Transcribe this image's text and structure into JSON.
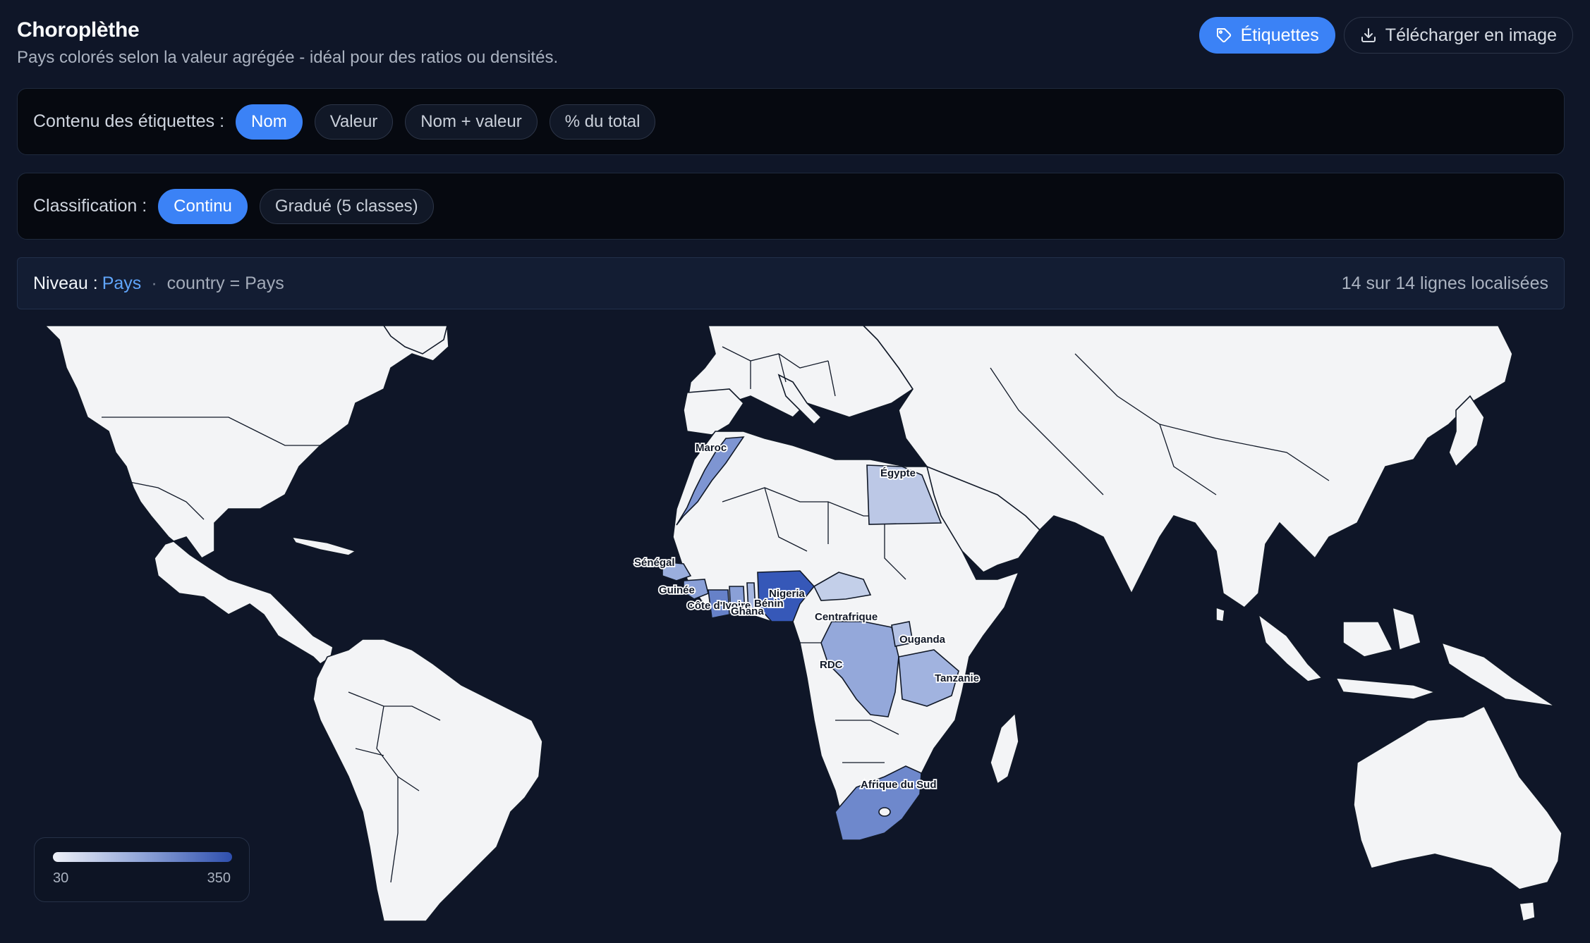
{
  "header": {
    "title": "Choroplèthe",
    "subtitle": "Pays colorés selon la valeur agrégée - idéal pour des ratios ou densités.",
    "labels_button": "Étiquettes",
    "download_button": "Télécharger en image"
  },
  "labels_panel": {
    "label": "Contenu des étiquettes :",
    "options": [
      "Nom",
      "Valeur",
      "Nom + valeur",
      "% du total"
    ],
    "selected": "Nom"
  },
  "classification_panel": {
    "label": "Classification :",
    "options": [
      "Continu",
      "Gradué (5 classes)"
    ],
    "selected": "Continu"
  },
  "level_bar": {
    "key": "Niveau :",
    "value": "Pays",
    "field": "country = Pays",
    "count": "14 sur 14 lignes localisées"
  },
  "map": {
    "colors": {
      "ocean": "#0f1628",
      "land": "#f3f4f6",
      "scale_low": "#eef1f8",
      "scale_high": "#2e4fae"
    },
    "countries": [
      {
        "name": "Maroc",
        "fill": "#7e95d2"
      },
      {
        "name": "Égypte",
        "fill": "#bcc8e6"
      },
      {
        "name": "Sénégal",
        "fill": "#9aaedd"
      },
      {
        "name": "Guinée",
        "fill": "#8aa0d7"
      },
      {
        "name": "Côte d'Ivoire",
        "fill": "#6681c8"
      },
      {
        "name": "Ghana",
        "fill": "#8aa0d7"
      },
      {
        "name": "Bénin",
        "fill": "#a7b8e1"
      },
      {
        "name": "Nigeria",
        "fill": "#3658b8"
      },
      {
        "name": "Centrafrique",
        "fill": "#c3cfe9"
      },
      {
        "name": "RDC",
        "fill": "#94a8da"
      },
      {
        "name": "Ouganda",
        "fill": "#b5c3e5"
      },
      {
        "name": "Tanzanie",
        "fill": "#a1b3df"
      },
      {
        "name": "Afrique du Sud",
        "fill": "#6e88cc"
      }
    ]
  },
  "legend": {
    "min": "30",
    "max": "350"
  }
}
